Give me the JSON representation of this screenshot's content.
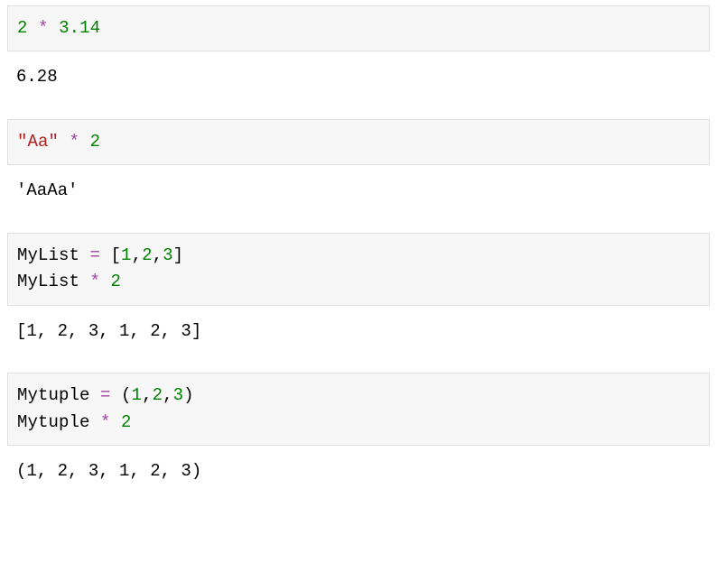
{
  "cells": [
    {
      "code_lines": [
        [
          {
            "cls": "tk-num",
            "t": "2"
          },
          {
            "cls": "tk-plain",
            "t": " "
          },
          {
            "cls": "tk-op",
            "t": "*"
          },
          {
            "cls": "tk-plain",
            "t": " "
          },
          {
            "cls": "tk-num",
            "t": "3.14"
          }
        ]
      ],
      "output": "6.28"
    },
    {
      "code_lines": [
        [
          {
            "cls": "tk-str",
            "t": "\"Aa\""
          },
          {
            "cls": "tk-plain",
            "t": " "
          },
          {
            "cls": "tk-op",
            "t": "*"
          },
          {
            "cls": "tk-plain",
            "t": " "
          },
          {
            "cls": "tk-num",
            "t": "2"
          }
        ]
      ],
      "output": "'AaAa'"
    },
    {
      "code_lines": [
        [
          {
            "cls": "tk-plain",
            "t": "MyList "
          },
          {
            "cls": "tk-op",
            "t": "="
          },
          {
            "cls": "tk-plain",
            "t": " ["
          },
          {
            "cls": "tk-num",
            "t": "1"
          },
          {
            "cls": "tk-plain",
            "t": ","
          },
          {
            "cls": "tk-num",
            "t": "2"
          },
          {
            "cls": "tk-plain",
            "t": ","
          },
          {
            "cls": "tk-num",
            "t": "3"
          },
          {
            "cls": "tk-plain",
            "t": "]"
          }
        ],
        [
          {
            "cls": "tk-plain",
            "t": "MyList "
          },
          {
            "cls": "tk-op",
            "t": "*"
          },
          {
            "cls": "tk-plain",
            "t": " "
          },
          {
            "cls": "tk-num",
            "t": "2"
          }
        ]
      ],
      "output": "[1, 2, 3, 1, 2, 3]"
    },
    {
      "code_lines": [
        [
          {
            "cls": "tk-plain",
            "t": "Mytuple "
          },
          {
            "cls": "tk-op",
            "t": "="
          },
          {
            "cls": "tk-plain",
            "t": " ("
          },
          {
            "cls": "tk-num",
            "t": "1"
          },
          {
            "cls": "tk-plain",
            "t": ","
          },
          {
            "cls": "tk-num",
            "t": "2"
          },
          {
            "cls": "tk-plain",
            "t": ","
          },
          {
            "cls": "tk-num",
            "t": "3"
          },
          {
            "cls": "tk-plain",
            "t": ")"
          }
        ],
        [
          {
            "cls": "tk-plain",
            "t": "Mytuple "
          },
          {
            "cls": "tk-op",
            "t": "*"
          },
          {
            "cls": "tk-plain",
            "t": " "
          },
          {
            "cls": "tk-num",
            "t": "2"
          }
        ]
      ],
      "output": "(1, 2, 3, 1, 2, 3)"
    }
  ]
}
